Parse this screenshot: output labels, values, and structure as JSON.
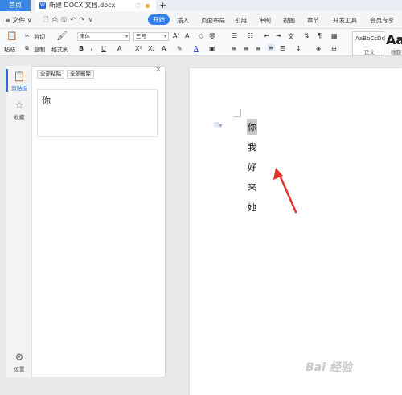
{
  "window": {
    "home_tab": "首页",
    "doc_tab_icon": "W",
    "doc_tab_title": "新建 DOCX 文档.docx",
    "add_tab": "+"
  },
  "menubar": {
    "file": "≡ 文件 ∨",
    "quick": "🗋 ⎙ 🖫 ↶ ↷ ∨",
    "tabs": [
      "开始",
      "插入",
      "页面布局",
      "引用",
      "审阅",
      "视图",
      "章节",
      "开发工具",
      "会员专享"
    ]
  },
  "toolbar": {
    "paste": "粘贴",
    "cut": "剪切",
    "copy": "复制",
    "format_painter": "格式刷",
    "font_name": "宋体",
    "font_size": "三号",
    "style_sample": "AaBbCcDd",
    "style_name": "正文",
    "style_big": "Aa",
    "style_big_label": "标题"
  },
  "sidenav": {
    "items": [
      {
        "label": "剪贴板",
        "icon": "clipboard-icon"
      },
      {
        "label": "收藏",
        "icon": "star-icon"
      },
      {
        "label": "设置",
        "icon": "gear-icon"
      }
    ]
  },
  "clipboard_pane": {
    "paste_all": "全部粘贴",
    "delete_all": "全部删除",
    "items": [
      "你"
    ],
    "close": "×"
  },
  "document": {
    "lines": [
      "你",
      "我",
      "好",
      "来",
      "她"
    ],
    "selected_index": 0
  },
  "watermark": "Bai 经验"
}
